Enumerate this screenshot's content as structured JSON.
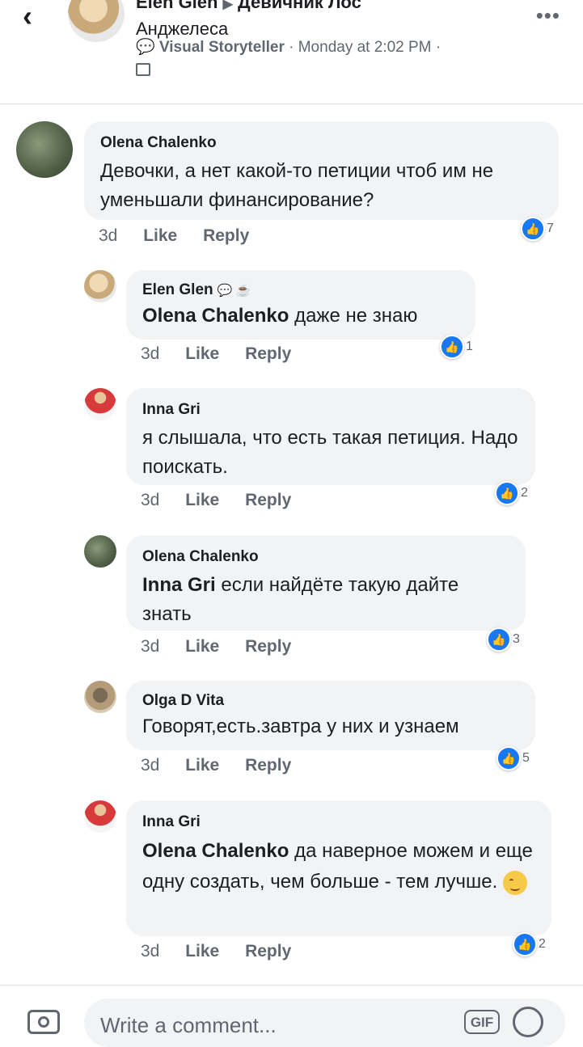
{
  "header": {
    "author": "Elen Glen",
    "arrow": "▶",
    "group_line1": "Девичник Лос",
    "group_line2": "Анджелеса",
    "badge": "Visual Storyteller",
    "time": "Monday at 2:02 PM",
    "dot": "·"
  },
  "comments": [
    {
      "name": "Olena Chalenko",
      "mention": "",
      "text": "Девочки, а нет какой-то петиции чтоб им не уменьшали финансирование?",
      "time": "3d",
      "like": "Like",
      "reply": "Reply",
      "reactions": "7"
    },
    {
      "name": "Elen Glen",
      "mention": "Olena Chalenko",
      "text": "даже не знаю",
      "time": "3d",
      "like": "Like",
      "reply": "Reply",
      "reactions": "1"
    },
    {
      "name": "Inna Gri",
      "mention": "",
      "text": "я слышала, что есть такая петиция. Надо поискать.",
      "time": "3d",
      "like": "Like",
      "reply": "Reply",
      "reactions": "2"
    },
    {
      "name": "Olena Chalenko",
      "mention": "Inna Gri",
      "text": "если найдёте такую дайте знать",
      "time": "3d",
      "like": "Like",
      "reply": "Reply",
      "reactions": "3"
    },
    {
      "name": "Olga D Vita",
      "mention": "",
      "text": "Говорят,есть.завтра у них и узнаем",
      "time": "3d",
      "like": "Like",
      "reply": "Reply",
      "reactions": "5"
    },
    {
      "name": "Inna Gri",
      "mention": "Olena Chalenko",
      "text": "да наверное можем и еще одну создать, чем больше - тем лучше.",
      "time": "3d",
      "like": "Like",
      "reply": "Reply",
      "reactions": "2"
    }
  ],
  "composer": {
    "placeholder": "Write a comment...",
    "gif": "GIF"
  },
  "icons": {
    "back": "chevron-left-icon",
    "more": "more-icon",
    "like": "like-icon",
    "camera": "camera-icon",
    "emoji": "emoji-icon"
  },
  "colors": {
    "like_blue": "#1877f2",
    "bubble": "#f2f3f5",
    "meta": "#606770"
  }
}
